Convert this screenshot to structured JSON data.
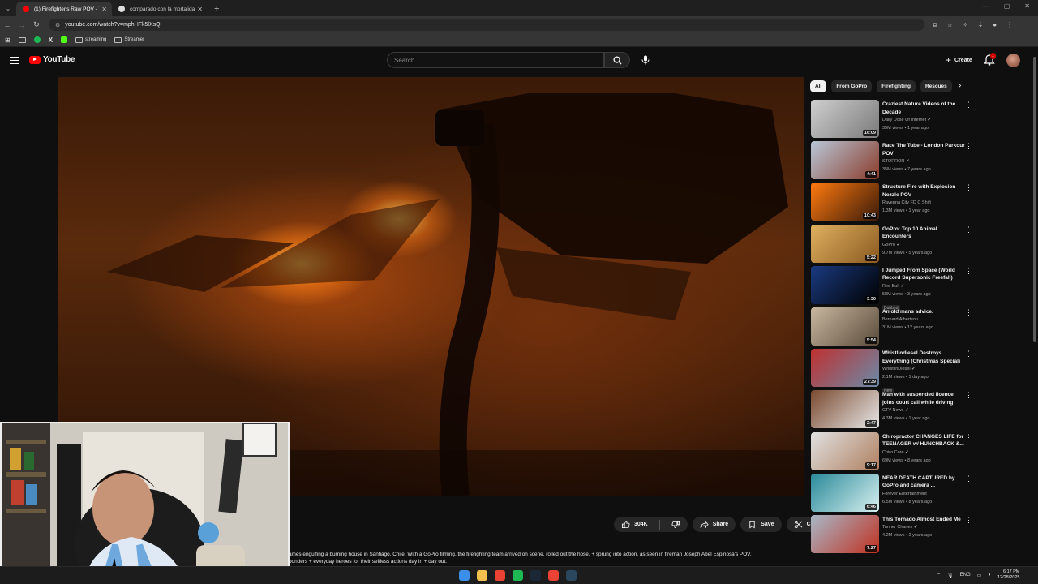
{
  "browser": {
    "tabs": [
      {
        "title": "(1) Firefighter's Raw POV - YouTube",
        "active": true,
        "favicon_color": "#ff0000"
      },
      {
        "title": "comparado con la mortalidad de...",
        "active": false,
        "favicon_color": "#4285f4"
      }
    ],
    "url": "youtube.com/watch?v=mphHFk5lXsQ",
    "bookmarks": [
      {
        "label": "",
        "icon": "folder-icon",
        "color": ""
      },
      {
        "label": "",
        "icon": "spotify-icon",
        "color": "#1db954"
      },
      {
        "label": "",
        "icon": "x-icon",
        "color": "#000000"
      },
      {
        "label": "",
        "icon": "kick-icon",
        "color": "#53fc18"
      },
      {
        "label": "streaming",
        "icon": "folder-icon",
        "color": ""
      },
      {
        "label": "Streamer",
        "icon": "folder-icon",
        "color": ""
      }
    ]
  },
  "header": {
    "logo_text": "YouTube",
    "search_placeholder": "Search",
    "create_label": "Create",
    "notification_count": "1"
  },
  "actions": {
    "like_count": "304K",
    "share_label": "Share",
    "save_label": "Save",
    "clip_label": "Clip"
  },
  "description": {
    "line1": "ames engulfing a burning house in Santiago, Chile. With a GoPro filming, the firefighting team arrived on scene, rolled out the hose, + sprung into action, as seen in fireman Joseph Abel Espinosa's POV.",
    "line2": "ponders + everyday heroes for their selfless actions day in + day out."
  },
  "chips": [
    "All",
    "From GoPro",
    "Firefighting",
    "Rescues"
  ],
  "recommendations": [
    {
      "title": "Craziest Nature Videos of the Decade",
      "channel": "Daily Dose Of Internet",
      "verified": true,
      "stats": "35M views • 1 year ago",
      "duration": "16:09",
      "badge": "",
      "colors": [
        "#cfcfcf",
        "#7a7a7a"
      ]
    },
    {
      "title": "Race The Tube - London Parkour POV",
      "channel": "STORROR",
      "verified": true,
      "stats": "35M views • 7 years ago",
      "duration": "4:41",
      "badge": "",
      "colors": [
        "#b8c8d8",
        "#8a3b2a"
      ]
    },
    {
      "title": "Structure Fire with Explosion Nozzle POV",
      "channel": "Ravenna City FD C Shift",
      "verified": false,
      "stats": "1.3M views • 1 year ago",
      "duration": "10:43",
      "badge": "",
      "colors": [
        "#ff7a10",
        "#3a1a08"
      ]
    },
    {
      "title": "GoPro: Top 10 Animal Encounters",
      "channel": "GoPro",
      "verified": true,
      "stats": "9.7M views • 5 years ago",
      "duration": "5:22",
      "badge": "",
      "colors": [
        "#e0b060",
        "#8a5a20"
      ]
    },
    {
      "title": "I Jumped From Space (World Record Supersonic Freefall)",
      "channel": "Red Bull",
      "verified": true,
      "stats": "58M views • 3 years ago",
      "duration": "3:30",
      "badge": "Dubbed",
      "colors": [
        "#1a3a80",
        "#000000"
      ]
    },
    {
      "title": "An old mans advice.",
      "channel": "Bernard Albertson",
      "verified": false,
      "stats": "31M views • 12 years ago",
      "duration": "5:54",
      "badge": "",
      "colors": [
        "#c8b8a0",
        "#5a4a3a"
      ]
    },
    {
      "title": "Whistlindiesel Destroys Everything (Christmas Special)",
      "channel": "WhistlinDiesel",
      "verified": true,
      "stats": "2.1M views • 1 day ago",
      "duration": "27:39",
      "badge": "New",
      "colors": [
        "#c03030",
        "#6a8aa8"
      ]
    },
    {
      "title": "Man with suspended licence joins court call while driving",
      "channel": "CTV News",
      "verified": true,
      "stats": "4.3M views • 1 year ago",
      "duration": "2:47",
      "badge": "",
      "colors": [
        "#7a4a30",
        "#e8e8e8"
      ]
    },
    {
      "title": "Chiropractor CHANGES LIFE for TEENAGER w/ HUNCHBACK &...",
      "channel": "Chiro Core",
      "verified": true,
      "stats": "69M views • 8 years ago",
      "duration": "9:17",
      "badge": "",
      "colors": [
        "#e0e0e0",
        "#b08060"
      ]
    },
    {
      "title": "NEAR DEATH CAPTURED by GoPro and camera ...",
      "channel": "Forever Entertainment",
      "verified": false,
      "stats": "6.5M views • 8 years ago",
      "duration": "6:46",
      "badge": "",
      "colors": [
        "#2a8a9a",
        "#d8f0f0"
      ]
    },
    {
      "title": "This Tornado Almost Ended Me",
      "channel": "Tanner Charles",
      "verified": true,
      "stats": "4.2M views • 2 years ago",
      "duration": "7:27",
      "badge": "",
      "colors": [
        "#a8b8c8",
        "#c03020"
      ]
    }
  ],
  "taskbar": {
    "language": "ENG",
    "time": "6:17 PM",
    "date": "12/28/2025",
    "apps": [
      {
        "icon": "windows-start-icon",
        "color": "#3b8eea"
      },
      {
        "icon": "file-explorer-icon",
        "color": "#f2c14e"
      },
      {
        "icon": "chrome-icon",
        "color": "#ea4335"
      },
      {
        "icon": "spotify-icon",
        "color": "#1db954"
      },
      {
        "icon": "steam-icon",
        "color": "#1b2838"
      },
      {
        "icon": "chrome-profile-icon",
        "color": "#ea4335"
      },
      {
        "icon": "steam-alt-icon",
        "color": "#2a475e"
      }
    ]
  }
}
